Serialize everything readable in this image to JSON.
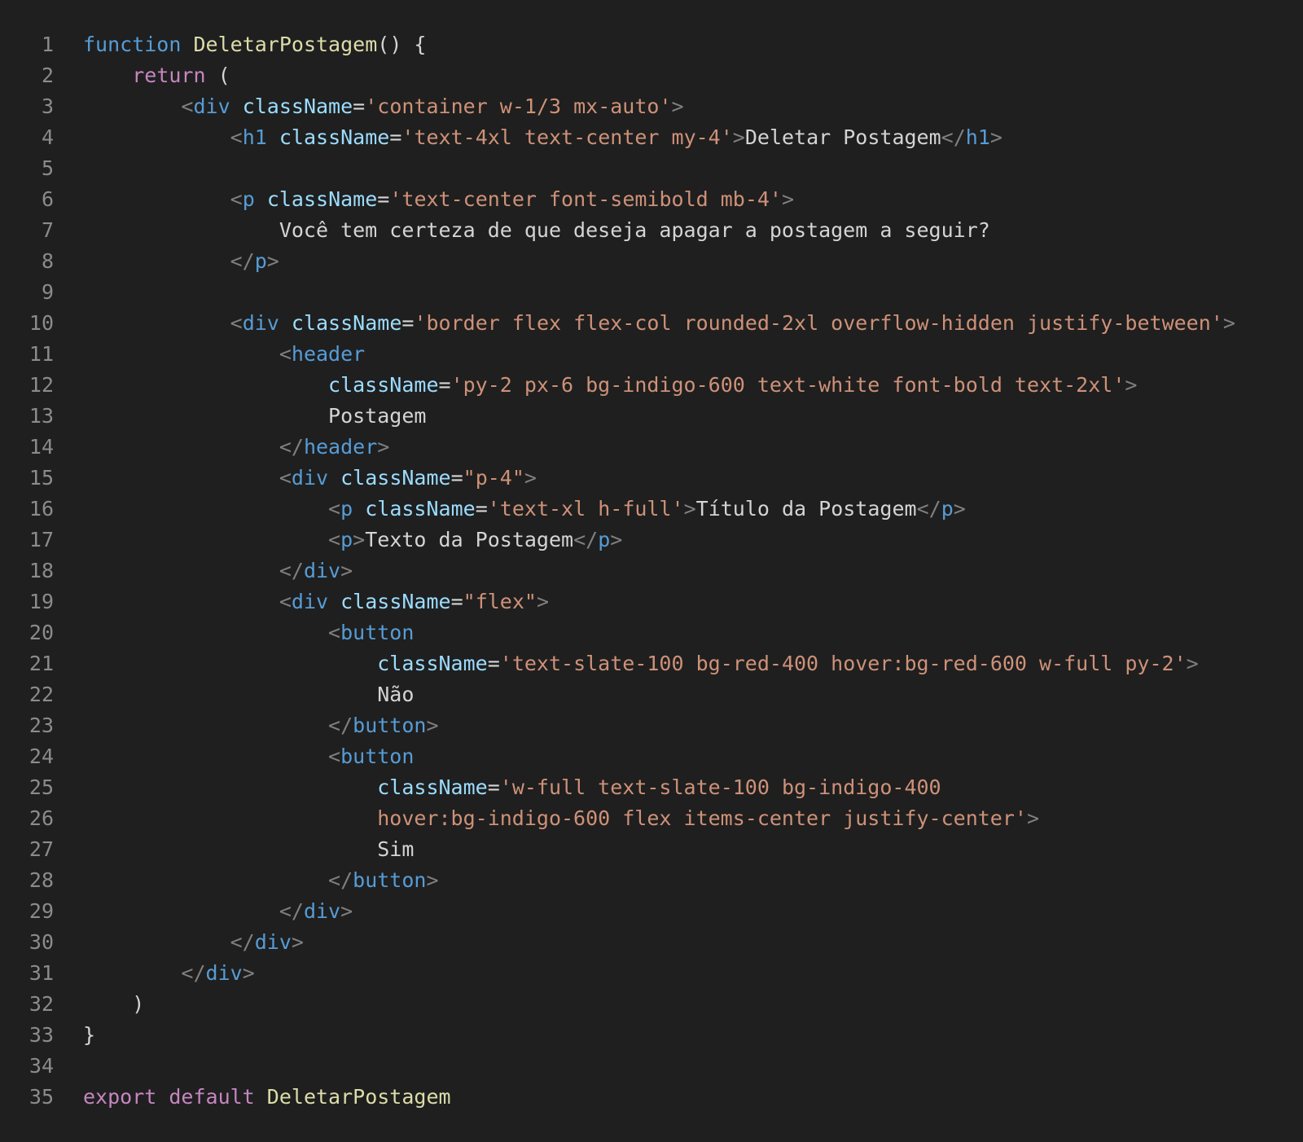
{
  "colors": {
    "background": "#1f1f1f",
    "line_number": "#8b8b8b",
    "keyword": "#569cd6",
    "control_keyword": "#c586c0",
    "function_name": "#dcdcaa",
    "tag": "#569cd6",
    "tag_bracket": "#808080",
    "attribute": "#9cdcfe",
    "string": "#ce9178",
    "text": "#d4d4d4"
  },
  "editor": {
    "lines": [
      {
        "number": "1",
        "tokens": [
          {
            "t": "kw",
            "v": "function"
          },
          {
            "t": "txt",
            "v": " "
          },
          {
            "t": "fn",
            "v": "DeletarPostagem"
          },
          {
            "t": "txt",
            "v": "() {"
          }
        ]
      },
      {
        "number": "2",
        "tokens": [
          {
            "t": "txt",
            "v": "    "
          },
          {
            "t": "ctl",
            "v": "return"
          },
          {
            "t": "txt",
            "v": " ("
          }
        ]
      },
      {
        "number": "3",
        "tokens": [
          {
            "t": "txt",
            "v": "        "
          },
          {
            "t": "br",
            "v": "<"
          },
          {
            "t": "tag",
            "v": "div"
          },
          {
            "t": "txt",
            "v": " "
          },
          {
            "t": "attr",
            "v": "className"
          },
          {
            "t": "txt",
            "v": "="
          },
          {
            "t": "str",
            "v": "'container w-1/3 mx-auto'"
          },
          {
            "t": "br",
            "v": ">"
          }
        ]
      },
      {
        "number": "4",
        "tokens": [
          {
            "t": "txt",
            "v": "            "
          },
          {
            "t": "br",
            "v": "<"
          },
          {
            "t": "tag",
            "v": "h1"
          },
          {
            "t": "txt",
            "v": " "
          },
          {
            "t": "attr",
            "v": "className"
          },
          {
            "t": "txt",
            "v": "="
          },
          {
            "t": "str",
            "v": "'text-4xl text-center my-4'"
          },
          {
            "t": "br",
            "v": ">"
          },
          {
            "t": "txt",
            "v": "Deletar Postagem"
          },
          {
            "t": "br",
            "v": "</"
          },
          {
            "t": "tag",
            "v": "h1"
          },
          {
            "t": "br",
            "v": ">"
          }
        ]
      },
      {
        "number": "5",
        "tokens": []
      },
      {
        "number": "6",
        "tokens": [
          {
            "t": "txt",
            "v": "            "
          },
          {
            "t": "br",
            "v": "<"
          },
          {
            "t": "tag",
            "v": "p"
          },
          {
            "t": "txt",
            "v": " "
          },
          {
            "t": "attr",
            "v": "className"
          },
          {
            "t": "txt",
            "v": "="
          },
          {
            "t": "str",
            "v": "'text-center font-semibold mb-4'"
          },
          {
            "t": "br",
            "v": ">"
          }
        ]
      },
      {
        "number": "7",
        "tokens": [
          {
            "t": "txt",
            "v": "                Você tem certeza de que deseja apagar a postagem a seguir?"
          }
        ]
      },
      {
        "number": "8",
        "tokens": [
          {
            "t": "txt",
            "v": "            "
          },
          {
            "t": "br",
            "v": "</"
          },
          {
            "t": "tag",
            "v": "p"
          },
          {
            "t": "br",
            "v": ">"
          }
        ]
      },
      {
        "number": "9",
        "tokens": []
      },
      {
        "number": "10",
        "tokens": [
          {
            "t": "txt",
            "v": "            "
          },
          {
            "t": "br",
            "v": "<"
          },
          {
            "t": "tag",
            "v": "div"
          },
          {
            "t": "txt",
            "v": " "
          },
          {
            "t": "attr",
            "v": "className"
          },
          {
            "t": "txt",
            "v": "="
          },
          {
            "t": "str",
            "v": "'border flex flex-col rounded-2xl overflow-hidden justify-between'"
          },
          {
            "t": "br",
            "v": ">"
          }
        ]
      },
      {
        "number": "11",
        "tokens": [
          {
            "t": "txt",
            "v": "                "
          },
          {
            "t": "br",
            "v": "<"
          },
          {
            "t": "tag",
            "v": "header"
          }
        ]
      },
      {
        "number": "12",
        "tokens": [
          {
            "t": "txt",
            "v": "                    "
          },
          {
            "t": "attr",
            "v": "className"
          },
          {
            "t": "txt",
            "v": "="
          },
          {
            "t": "str",
            "v": "'py-2 px-6 bg-indigo-600 text-white font-bold text-2xl'"
          },
          {
            "t": "br",
            "v": ">"
          }
        ]
      },
      {
        "number": "13",
        "tokens": [
          {
            "t": "txt",
            "v": "                    Postagem"
          }
        ]
      },
      {
        "number": "14",
        "tokens": [
          {
            "t": "txt",
            "v": "                "
          },
          {
            "t": "br",
            "v": "</"
          },
          {
            "t": "tag",
            "v": "header"
          },
          {
            "t": "br",
            "v": ">"
          }
        ]
      },
      {
        "number": "15",
        "tokens": [
          {
            "t": "txt",
            "v": "                "
          },
          {
            "t": "br",
            "v": "<"
          },
          {
            "t": "tag",
            "v": "div"
          },
          {
            "t": "txt",
            "v": " "
          },
          {
            "t": "attr",
            "v": "className"
          },
          {
            "t": "txt",
            "v": "="
          },
          {
            "t": "str",
            "v": "\"p-4\""
          },
          {
            "t": "br",
            "v": ">"
          }
        ]
      },
      {
        "number": "16",
        "tokens": [
          {
            "t": "txt",
            "v": "                    "
          },
          {
            "t": "br",
            "v": "<"
          },
          {
            "t": "tag",
            "v": "p"
          },
          {
            "t": "txt",
            "v": " "
          },
          {
            "t": "attr",
            "v": "className"
          },
          {
            "t": "txt",
            "v": "="
          },
          {
            "t": "str",
            "v": "'text-xl h-full'"
          },
          {
            "t": "br",
            "v": ">"
          },
          {
            "t": "txt",
            "v": "Título da Postagem"
          },
          {
            "t": "br",
            "v": "</"
          },
          {
            "t": "tag",
            "v": "p"
          },
          {
            "t": "br",
            "v": ">"
          }
        ]
      },
      {
        "number": "17",
        "tokens": [
          {
            "t": "txt",
            "v": "                    "
          },
          {
            "t": "br",
            "v": "<"
          },
          {
            "t": "tag",
            "v": "p"
          },
          {
            "t": "br",
            "v": ">"
          },
          {
            "t": "txt",
            "v": "Texto da Postagem"
          },
          {
            "t": "br",
            "v": "</"
          },
          {
            "t": "tag",
            "v": "p"
          },
          {
            "t": "br",
            "v": ">"
          }
        ]
      },
      {
        "number": "18",
        "tokens": [
          {
            "t": "txt",
            "v": "                "
          },
          {
            "t": "br",
            "v": "</"
          },
          {
            "t": "tag",
            "v": "div"
          },
          {
            "t": "br",
            "v": ">"
          }
        ]
      },
      {
        "number": "19",
        "tokens": [
          {
            "t": "txt",
            "v": "                "
          },
          {
            "t": "br",
            "v": "<"
          },
          {
            "t": "tag",
            "v": "div"
          },
          {
            "t": "txt",
            "v": " "
          },
          {
            "t": "attr",
            "v": "className"
          },
          {
            "t": "txt",
            "v": "="
          },
          {
            "t": "str",
            "v": "\"flex\""
          },
          {
            "t": "br",
            "v": ">"
          }
        ]
      },
      {
        "number": "20",
        "tokens": [
          {
            "t": "txt",
            "v": "                    "
          },
          {
            "t": "br",
            "v": "<"
          },
          {
            "t": "tag",
            "v": "button"
          }
        ]
      },
      {
        "number": "21",
        "tokens": [
          {
            "t": "txt",
            "v": "                        "
          },
          {
            "t": "attr",
            "v": "className"
          },
          {
            "t": "txt",
            "v": "="
          },
          {
            "t": "str",
            "v": "'text-slate-100 bg-red-400 hover:bg-red-600 w-full py-2'"
          },
          {
            "t": "br",
            "v": ">"
          }
        ]
      },
      {
        "number": "22",
        "tokens": [
          {
            "t": "txt",
            "v": "                        Não"
          }
        ]
      },
      {
        "number": "23",
        "tokens": [
          {
            "t": "txt",
            "v": "                    "
          },
          {
            "t": "br",
            "v": "</"
          },
          {
            "t": "tag",
            "v": "button"
          },
          {
            "t": "br",
            "v": ">"
          }
        ]
      },
      {
        "number": "24",
        "tokens": [
          {
            "t": "txt",
            "v": "                    "
          },
          {
            "t": "br",
            "v": "<"
          },
          {
            "t": "tag",
            "v": "button"
          }
        ]
      },
      {
        "number": "25",
        "tokens": [
          {
            "t": "txt",
            "v": "                        "
          },
          {
            "t": "attr",
            "v": "className"
          },
          {
            "t": "txt",
            "v": "="
          },
          {
            "t": "str",
            "v": "'w-full text-slate-100 bg-indigo-400"
          }
        ]
      },
      {
        "number": "26",
        "tokens": [
          {
            "t": "str",
            "v": "                        hover:bg-indigo-600 flex items-center justify-center'"
          },
          {
            "t": "br",
            "v": ">"
          }
        ]
      },
      {
        "number": "27",
        "tokens": [
          {
            "t": "txt",
            "v": "                        Sim"
          }
        ]
      },
      {
        "number": "28",
        "tokens": [
          {
            "t": "txt",
            "v": "                    "
          },
          {
            "t": "br",
            "v": "</"
          },
          {
            "t": "tag",
            "v": "button"
          },
          {
            "t": "br",
            "v": ">"
          }
        ]
      },
      {
        "number": "29",
        "tokens": [
          {
            "t": "txt",
            "v": "                "
          },
          {
            "t": "br",
            "v": "</"
          },
          {
            "t": "tag",
            "v": "div"
          },
          {
            "t": "br",
            "v": ">"
          }
        ]
      },
      {
        "number": "30",
        "tokens": [
          {
            "t": "txt",
            "v": "            "
          },
          {
            "t": "br",
            "v": "</"
          },
          {
            "t": "tag",
            "v": "div"
          },
          {
            "t": "br",
            "v": ">"
          }
        ]
      },
      {
        "number": "31",
        "tokens": [
          {
            "t": "txt",
            "v": "        "
          },
          {
            "t": "br",
            "v": "</"
          },
          {
            "t": "tag",
            "v": "div"
          },
          {
            "t": "br",
            "v": ">"
          }
        ]
      },
      {
        "number": "32",
        "tokens": [
          {
            "t": "txt",
            "v": "    )"
          }
        ]
      },
      {
        "number": "33",
        "tokens": [
          {
            "t": "txt",
            "v": "}"
          }
        ]
      },
      {
        "number": "34",
        "tokens": []
      },
      {
        "number": "35",
        "tokens": [
          {
            "t": "ctl",
            "v": "export"
          },
          {
            "t": "txt",
            "v": " "
          },
          {
            "t": "ctl",
            "v": "default"
          },
          {
            "t": "txt",
            "v": " "
          },
          {
            "t": "fn",
            "v": "DeletarPostagem"
          }
        ]
      }
    ]
  }
}
